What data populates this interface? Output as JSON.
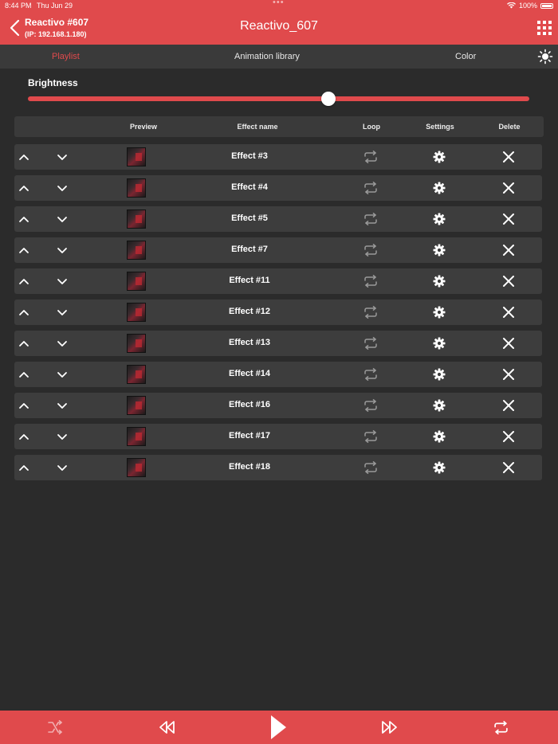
{
  "status_bar": {
    "time": "8:44 PM",
    "date": "Thu Jun 29",
    "battery": "100%"
  },
  "header": {
    "device_name": "Reactivo #607",
    "device_ip": "(IP: 192.168.1.180)",
    "title": "Reactivo_607"
  },
  "tabs": [
    {
      "label": "Playlist",
      "active": true
    },
    {
      "label": "Animation library",
      "active": false
    },
    {
      "label": "Color",
      "active": false
    }
  ],
  "brightness": {
    "label": "Brightness",
    "value_fraction": 0.6
  },
  "table": {
    "columns": {
      "preview": "Preview",
      "effect_name": "Effect name",
      "loop": "Loop",
      "settings": "Settings",
      "delete": "Delete"
    },
    "rows": [
      {
        "name": "Effect #3"
      },
      {
        "name": "Effect #4"
      },
      {
        "name": "Effect #5"
      },
      {
        "name": "Effect #7"
      },
      {
        "name": "Effect #11"
      },
      {
        "name": "Effect #12"
      },
      {
        "name": "Effect #13"
      },
      {
        "name": "Effect #14"
      },
      {
        "name": "Effect #16"
      },
      {
        "name": "Effect #17"
      },
      {
        "name": "Effect #18"
      }
    ]
  },
  "colors": {
    "accent": "#e04a4c",
    "background": "#2b2b2b",
    "row": "#3d3d3d"
  },
  "icons": [
    "back-icon",
    "apps-grid-icon",
    "sun-icon",
    "chevron-up-icon",
    "chevron-down-icon",
    "repeat-icon",
    "gear-icon",
    "close-icon",
    "shuffle-icon",
    "rewind-icon",
    "play-icon",
    "fast-forward-icon"
  ]
}
